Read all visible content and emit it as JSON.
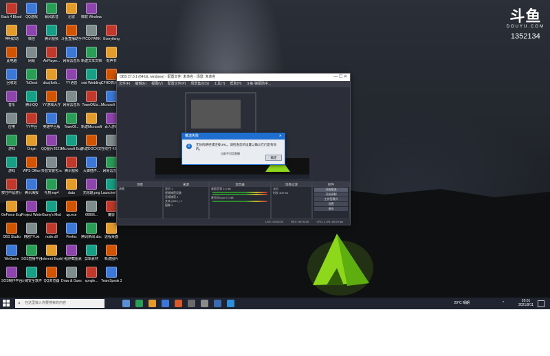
{
  "stream_overlay": {
    "brand": "斗鱼",
    "brand_sub": "DOUYU.COM",
    "room_number": "1352134"
  },
  "desktop": {
    "icons": [
      [
        "Back 4 Blood Beta",
        "QQ游戏",
        "暴风影音",
        "迅雷",
        "微软 Windows..."
      ],
      [
        "神明联动",
        "微信",
        "腾讯视频",
        "斗鱼直播助手",
        "PICO PARK",
        "Everything"
      ],
      [
        "此电脑",
        "网易",
        "AirPlayer...",
        "网易云音乐",
        "新建文本文档.txt",
        "有声书"
      ],
      [
        "回收站",
        "ToDesk",
        "dica(Ibrib...",
        "YY语音",
        "raid Wedding",
        "CFHD高清特效"
      ],
      [
        "音乐",
        "腾讯QQ",
        "YY游戏大厅",
        "网易云音乐",
        "TownOfUs...",
        "Microsoft Store"
      ],
      [
        "应用",
        "YY平台",
        "英雄平台版",
        "TownOf...",
        "新建Microsoft .doc",
        "百人游戏"
      ],
      [
        "游戏",
        "Origin",
        "QQ图片20210...",
        "Microsoft Edge",
        "新建DOCX文档.docx",
        "在线打卡的 游戏"
      ],
      [
        "游戏",
        "WPS Office",
        "抖音安装包.exe",
        "腾讯视频",
        "大脚插件...",
        "网易云音乐"
      ],
      [
        "按住中鼠进行...",
        "腾讯海报",
        "礼物.mp4",
        "data",
        "无标题.png",
        "Launcher快捷方式"
      ],
      [
        "GeForce Experience",
        "Project Winter",
        "Gamy's Mod",
        "up.exe",
        "66666...",
        "魔兽"
      ],
      [
        "OBS Studio",
        "韩剧TV.txt",
        "node.dll",
        "Firefox",
        "腾讯新闻.doc",
        "远程桌面"
      ],
      [
        "WeGame",
        "SOS直播平台",
        "Internet Explorer",
        "小程序截图素材",
        "剪辑素材",
        "新建图片"
      ],
      [
        "SOS制作平台 2.0",
        "火绒安全软件",
        "QQ浏览器",
        "Draw & Guess",
        "spngle...",
        "TeamSpeak 3"
      ]
    ]
  },
  "obs": {
    "title": "OBS 27.0.1 (64-bit, windows) - 配置文件: 未命名 - 场景: 未命名",
    "menu": [
      "文件(F)",
      "编辑(E)",
      "视图(V)",
      "配置文件(P)",
      "场景集合(S)",
      "工具(T)",
      "帮助(H)",
      "斗鱼-弹幕助手..."
    ],
    "docks": {
      "scenes_title": "场景",
      "scenes": [
        "场景"
      ],
      "sources_title": "来源",
      "sources": [
        "显示 1",
        "视频捕获设备",
        "音频捕获 1",
        "文本 (GDI+) 1",
        "图像 1"
      ],
      "mixer_title": "混音器",
      "mixer": [
        {
          "name": "桌面音频",
          "level": "0.0 dB"
        },
        {
          "name": "麦克风/Aux",
          "level": "0.0 dB"
        }
      ],
      "transitions_title": "场景过渡",
      "transition": "淡出",
      "duration_label": "时长",
      "duration": "300 ms",
      "controls_title": "控件",
      "controls": [
        "开始推流",
        "开始录制",
        "工作室模式",
        "设置",
        "退出"
      ]
    },
    "status": {
      "live": "LIVE: 00:00:00",
      "rec": "REC: 00:00:00",
      "cpu": "CPU: 1.3%, 60.00 fps"
    }
  },
  "dialog": {
    "title": "推流失败",
    "message": "无效的路径或连接URL。请检查您的设置以确认它们是有效的。",
    "sub": "当前不可用直播",
    "ok": "确定"
  },
  "taskbar": {
    "search_placeholder": "在这里输入你要搜索的内容",
    "weather": "29°C 晴朗",
    "time": "20:01",
    "date": "2021/9/11",
    "icon_colors": [
      "#5a8fd8",
      "#2a9d57",
      "#e39b2a",
      "#3c78d8",
      "#d85a2a",
      "#6b6b6b",
      "#8a8a8a",
      "#3a6ab0",
      "#2e8fd8"
    ]
  }
}
